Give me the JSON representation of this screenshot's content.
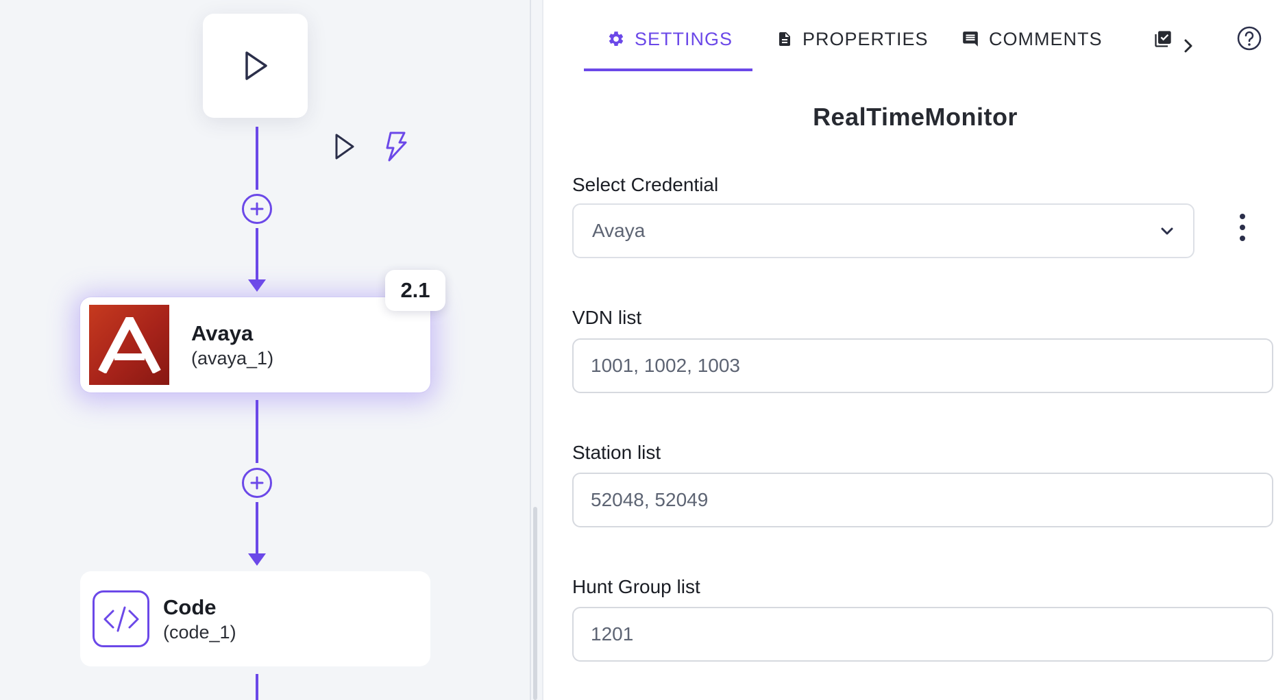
{
  "canvas": {
    "avaya_node": {
      "title": "Avaya",
      "subtitle": "(avaya_1)",
      "version": "2.1"
    },
    "code_node": {
      "title": "Code",
      "subtitle": "(code_1)"
    }
  },
  "panel": {
    "tabs": [
      {
        "label": "SETTINGS",
        "icon": "gear-icon",
        "active": true
      },
      {
        "label": "PROPERTIES",
        "icon": "document-icon",
        "active": false
      },
      {
        "label": "COMMENTS",
        "icon": "comment-icon",
        "active": false
      }
    ],
    "title": "RealTimeMonitor",
    "credential": {
      "label": "Select Credential",
      "value": "Avaya"
    },
    "vdn": {
      "label": "VDN list",
      "value": "1001, 1002, 1003"
    },
    "station": {
      "label": "Station list",
      "value": "52048, 52049"
    },
    "hunt_group": {
      "label": "Hunt Group list",
      "value": "1201"
    }
  },
  "colors": {
    "accent": "#6b48e8",
    "avaya_red": "#b02a1c",
    "canvas_bg": "#f3f5f8"
  }
}
